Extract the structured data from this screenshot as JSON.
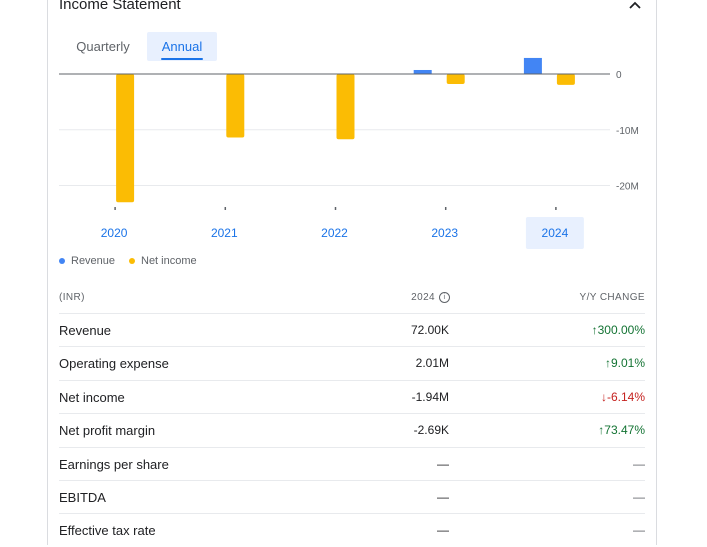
{
  "section": {
    "title": "Income Statement",
    "collapse_icon": "chevron-up-icon"
  },
  "tabs": [
    {
      "label": "Quarterly",
      "selected": false
    },
    {
      "label": "Annual",
      "selected": true
    }
  ],
  "chart_data": {
    "type": "bar",
    "categories": [
      "2020",
      "2021",
      "2022",
      "2023",
      "2024"
    ],
    "selected_category": "2024",
    "series": [
      {
        "name": "Revenue",
        "color": "#4285f4",
        "values": [
          0,
          0,
          0,
          0.018,
          0.072
        ]
      },
      {
        "name": "Net income",
        "color": "#fbbc04",
        "values": [
          -23.0,
          -11.4,
          -11.7,
          -1.8,
          -1.94
        ]
      }
    ],
    "y_unit": "M",
    "yticks": [
      {
        "value": 0,
        "label": "0"
      },
      {
        "value": -10,
        "label": "-10M"
      },
      {
        "value": -20,
        "label": "-20M"
      }
    ],
    "ylim": [
      -24,
      0
    ],
    "grid": true,
    "legend_position": "bottom-left"
  },
  "legend": [
    {
      "label": "Revenue",
      "color": "#4285f4"
    },
    {
      "label": "Net income",
      "color": "#fbbc04"
    }
  ],
  "table": {
    "currency": "(INR)",
    "period": "2024",
    "change_header": "Y/Y CHANGE",
    "rows": [
      {
        "label": "Revenue",
        "value": "72.00K",
        "change": "300.00%",
        "dir": "up"
      },
      {
        "label": "Operating expense",
        "value": "2.01M",
        "change": "9.01%",
        "dir": "up"
      },
      {
        "label": "Net income",
        "value": "-1.94M",
        "change": "-6.14%",
        "dir": "down"
      },
      {
        "label": "Net profit margin",
        "value": "-2.69K",
        "change": "73.47%",
        "dir": "up"
      },
      {
        "label": "Earnings per share",
        "value": "—",
        "change": "—",
        "dir": "none"
      },
      {
        "label": "EBITDA",
        "value": "—",
        "change": "—",
        "dir": "none"
      },
      {
        "label": "Effective tax rate",
        "value": "—",
        "change": "—",
        "dir": "none"
      }
    ]
  }
}
